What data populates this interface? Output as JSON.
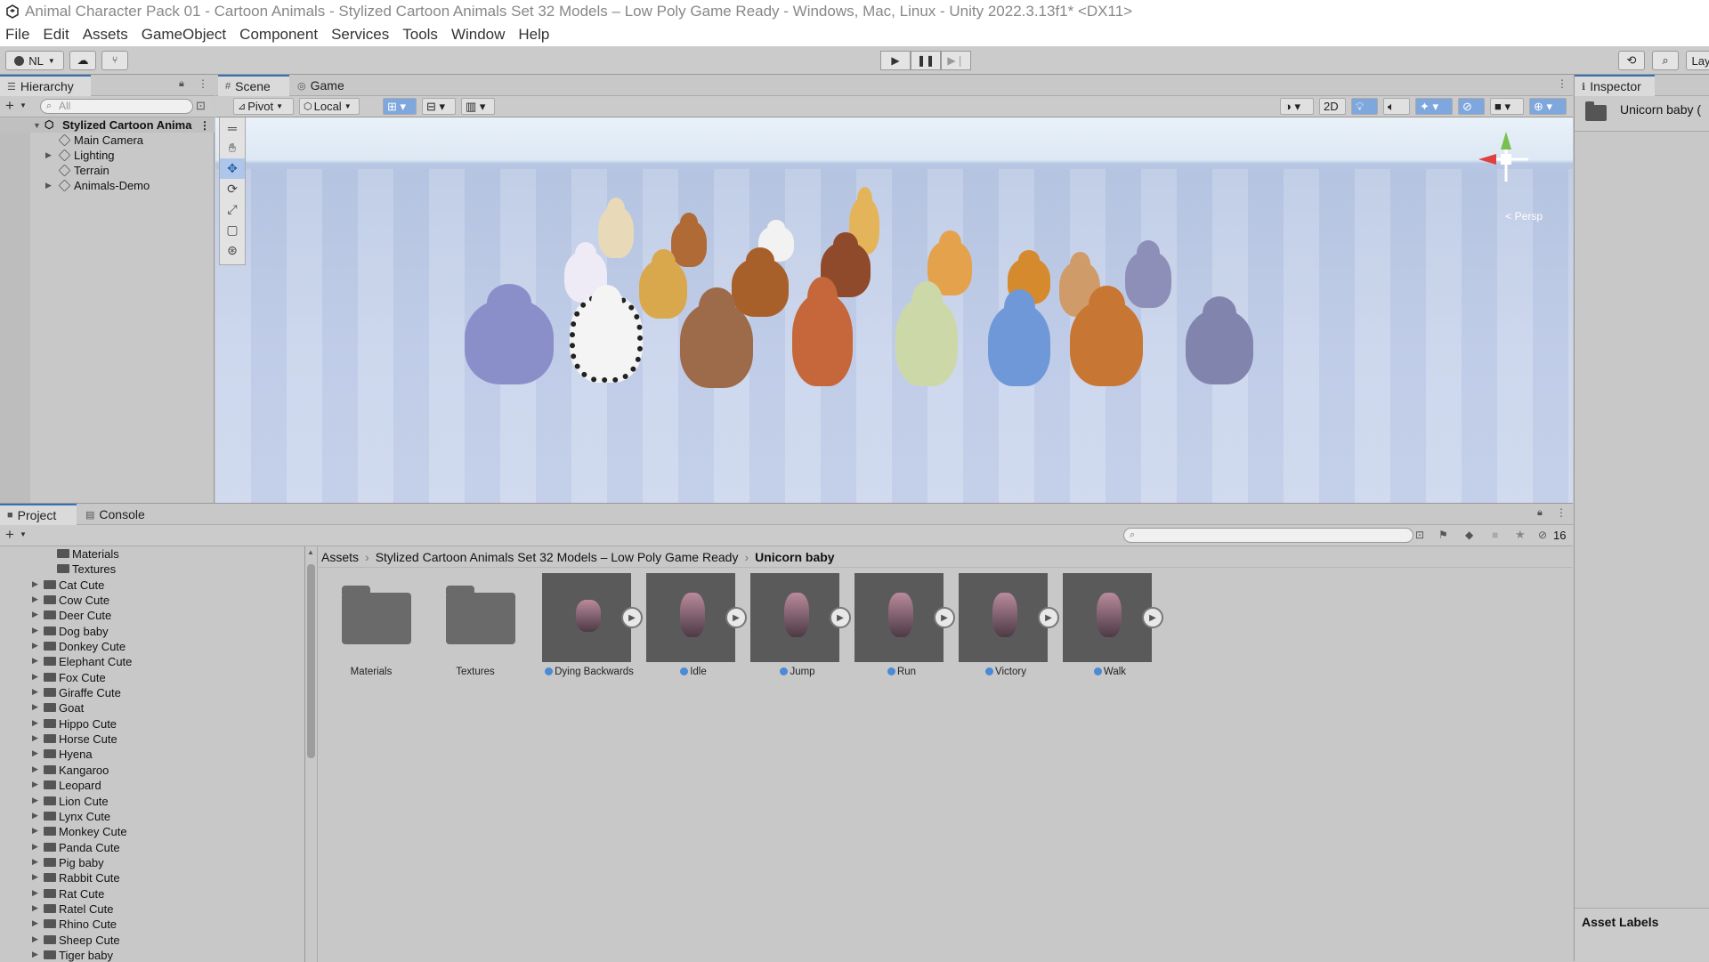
{
  "window": {
    "title": "Animal Character Pack 01 - Cartoon Animals - Stylized Cartoon Animals Set 32 Models – Low Poly Game Ready - Windows, Mac, Linux - Unity 2022.3.13f1* <DX11>"
  },
  "menu": [
    "File",
    "Edit",
    "Assets",
    "GameObject",
    "Component",
    "Services",
    "Tools",
    "Window",
    "Help"
  ],
  "toolbar": {
    "account": "NL",
    "layout": "Lay"
  },
  "hierarchy": {
    "tab": "Hierarchy",
    "search_placeholder": "All",
    "scene": "Stylized Cartoon Anima",
    "items": [
      "Main Camera",
      "Lighting",
      "Terrain",
      "Animals-Demo"
    ]
  },
  "scene_view": {
    "tabs": [
      "Scene",
      "Game"
    ],
    "pivot": "Pivot",
    "space": "Local",
    "mode_2d": "2D",
    "persp_label": "< Persp"
  },
  "inspector": {
    "tab": "Inspector",
    "asset_name": "Unicorn baby (",
    "labels_header": "Asset Labels"
  },
  "project": {
    "tabs": [
      "Project",
      "Console"
    ],
    "visible_count": "16",
    "tree_sub": [
      "Materials",
      "Textures"
    ],
    "tree": [
      "Cat Cute",
      "Cow Cute",
      "Deer Cute",
      "Dog baby",
      "Donkey Cute",
      "Elephant Cute",
      "Fox Cute",
      "Giraffe Cute",
      "Goat",
      "Hippo Cute",
      "Horse Cute",
      "Hyena",
      "Kangaroo",
      "Leopard",
      "Lion Cute",
      "Lynx Cute",
      "Monkey Cute",
      "Panda Cute",
      "Pig baby",
      "Rabbit Cute",
      "Rat Cute",
      "Ratel Cute",
      "Rhino Cute",
      "Sheep Cute",
      "Tiger baby"
    ],
    "breadcrumb": [
      "Assets",
      "Stylized Cartoon Animals Set 32 Models – Low Poly Game Ready",
      "Unicorn baby"
    ],
    "folders": [
      "Materials",
      "Textures"
    ],
    "animations": [
      "Dying Backwards",
      "Idle",
      "Jump",
      "Run",
      "Victory",
      "Walk"
    ]
  }
}
